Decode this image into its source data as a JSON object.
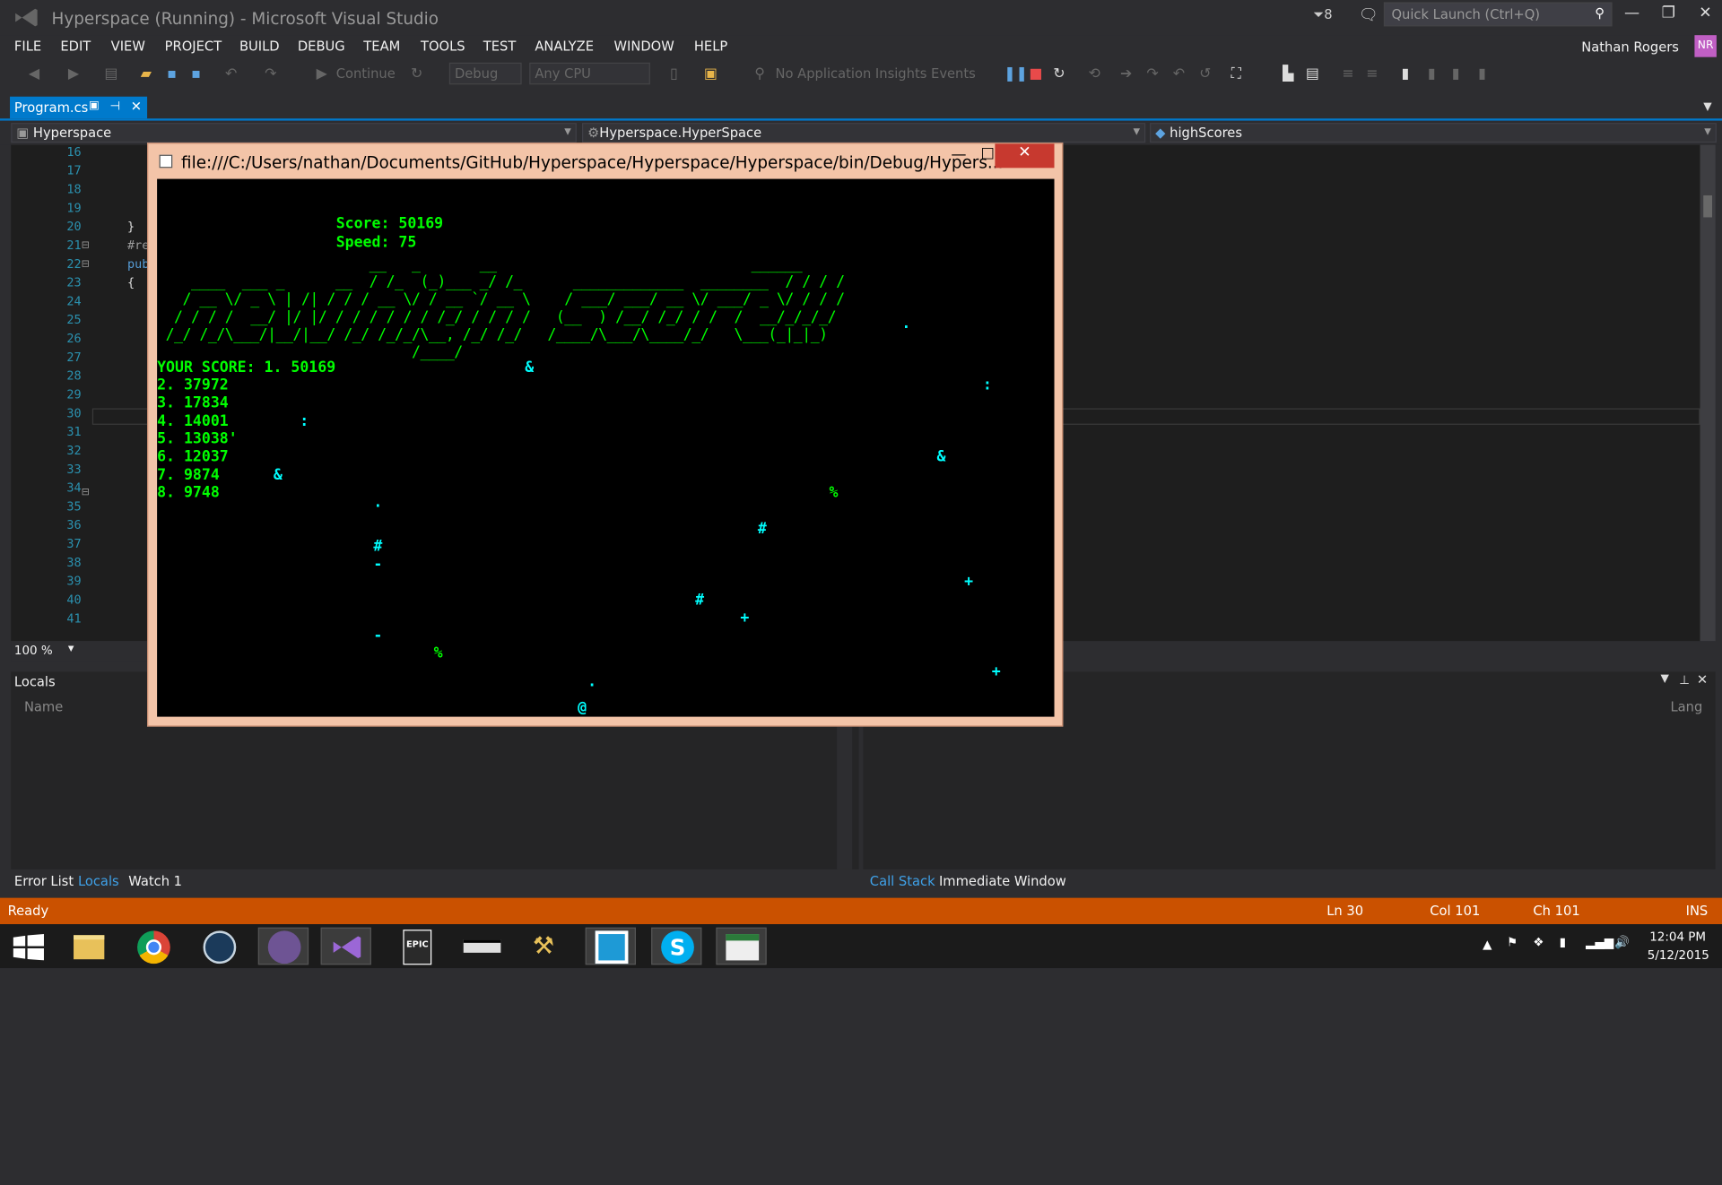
{
  "window": {
    "title": "Hyperspace (Running) - Microsoft Visual Studio",
    "notifications": "8",
    "quick_launch": "Quick Launch (Ctrl+Q)"
  },
  "menu": [
    "FILE",
    "EDIT",
    "VIEW",
    "PROJECT",
    "BUILD",
    "DEBUG",
    "TEAM",
    "TOOLS",
    "TEST",
    "ANALYZE",
    "WINDOW",
    "HELP"
  ],
  "user": {
    "name": "Nathan Rogers",
    "initials": "NR"
  },
  "toolbar": {
    "continue": "Continue",
    "config": "Debug",
    "platform": "Any CPU",
    "insights": "No Application Insights Events"
  },
  "tab": {
    "label": "Program.cs"
  },
  "navbar": {
    "project": "Hyperspace",
    "class": "Hyperspace.HyperSpace",
    "member": "highScores"
  },
  "editor": {
    "lines": [
      "16",
      "17",
      "18",
      "19",
      "20",
      "21",
      "22",
      "23",
      "24",
      "25",
      "26",
      "27",
      "28",
      "29",
      "30",
      "31",
      "32",
      "33",
      "34",
      "35",
      "36",
      "37",
      "38",
      "39",
      "40",
      "41"
    ],
    "code": {
      "l20": "}",
      "l21": "#re",
      "l22": "pub",
      "l23": "{"
    },
    "zoom": "100 %"
  },
  "locals": {
    "title": "Locals",
    "col_name": "Name",
    "col_lang": "Lang",
    "tabs": [
      "Error List",
      "Locals",
      "Watch 1"
    ]
  },
  "callstack": {
    "tabs": [
      "Call Stack",
      "Immediate Window"
    ]
  },
  "status": {
    "ready": "Ready",
    "ln": "Ln 30",
    "col": "Col 101",
    "ch": "Ch 101",
    "ins": "INS"
  },
  "console": {
    "title": "file:///C:/Users/nathan/Documents/GitHub/Hyperspace/Hyperspace/Hyperspace/bin/Debug/Hypers...",
    "score": "Score: 50169",
    "speed": "Speed: 75",
    "ascii": "                         __   _       __                              ______\n    ____  ___ _      __  / /_  (_)___ _/ /_      _____________  ________  / / / /\n   / __ \\/ _ \\ | /| / / / __ \\/ / __ `/ __ \\    / ___/ ___/ __ \\/ ___/ _ \\/ / / /\n  / / / /  __/ |/ |/ / / / / / / /_/ / / / /   (__  ) /__/ /_/ / /  /  __/_/_/_/\n /_/ /_/\\___/|__/|__/ /_/ /_/_/\\__, /_/ /_/   /____/\\___/\\____/_/   \\___(_|_|_)\n                              /____/",
    "your_score": "YOUR SCORE: 1. 50169",
    "scores": [
      "2. 37972",
      "3. 17834",
      "4. 14001",
      "5. 13038'",
      "6. 12037",
      "7. 9874",
      "8. 9748"
    ]
  },
  "taskbar": {
    "time": "12:04 PM",
    "date": "5/12/2015"
  },
  "colors": {
    "accent": "#007acc",
    "status": "#ca5100",
    "console_text": "#00ff00",
    "stars": "#00ffff"
  }
}
